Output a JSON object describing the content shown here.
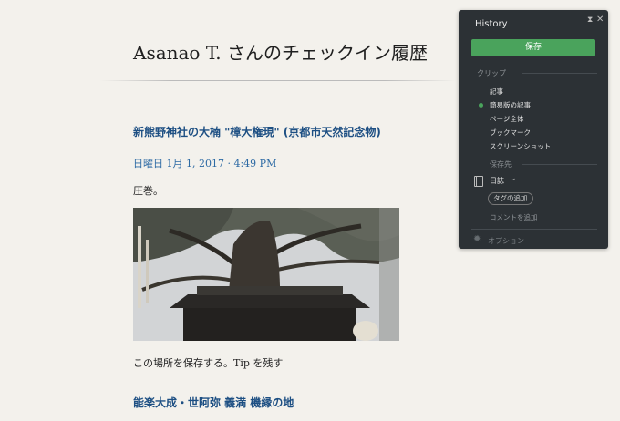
{
  "page": {
    "title": "Asanao T. さんのチェックイン履歴"
  },
  "post": {
    "title": "新熊野神社の大楠 \"樟大権現\" (京都市天然記念物)",
    "date": "日曜日 1月 1, 2017 · 4:49 PM",
    "text": "圧巻。",
    "footer": "この場所を保存する。Tip を残す"
  },
  "post2": {
    "title": "能楽大成・世阿弥 義満 機縁の地"
  },
  "clipper": {
    "brand": "History",
    "save_label": "保存",
    "clip_section": "クリップ",
    "clip_items": [
      "記事",
      "簡易版の記事",
      "ページ全体",
      "ブックマーク",
      "スクリーンショット"
    ],
    "selected_index": 1,
    "save_to_section": "保存先",
    "notebook": "日誌",
    "add_tag": "タグの追加",
    "add_comment": "コメントを追加",
    "options": "オプション",
    "accent": "#4aa35c"
  },
  "icons": {
    "pin": "pin-icon",
    "close": "close-icon",
    "notebook": "notebook-icon",
    "chevron": "chevron-down-icon",
    "gear": "gear-icon"
  }
}
